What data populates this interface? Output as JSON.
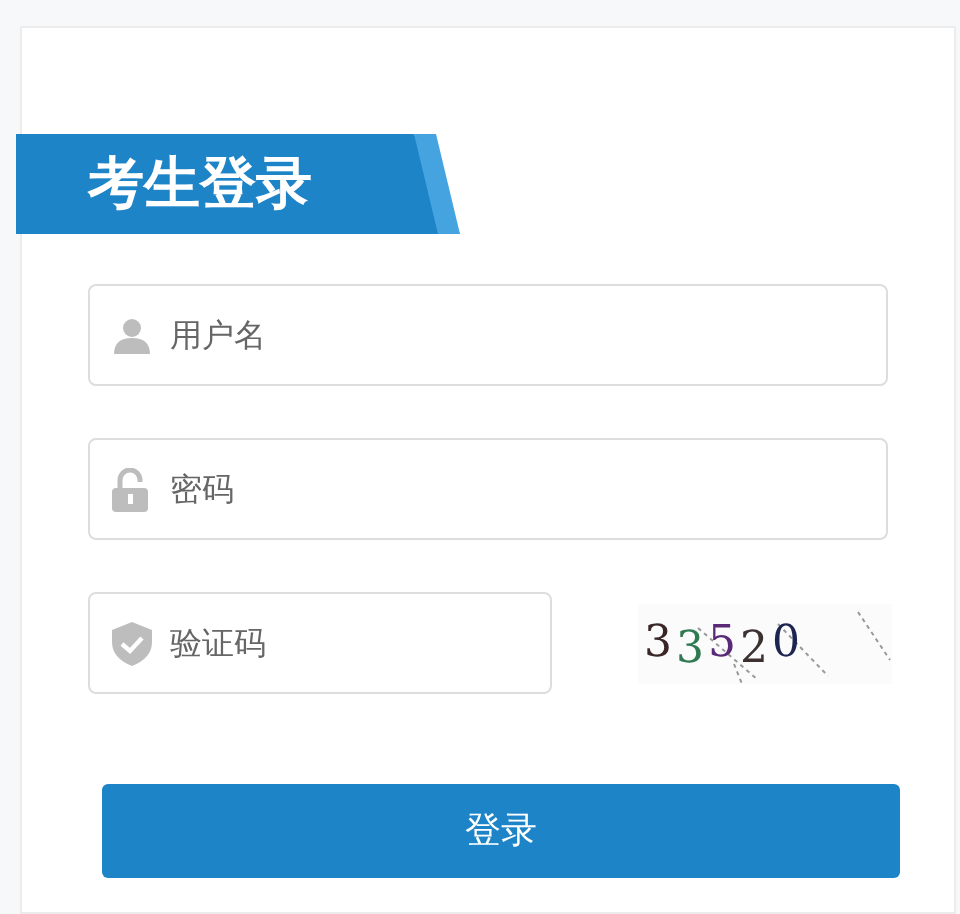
{
  "title": "考生登录",
  "fields": [
    {
      "kind": "user",
      "placeholder": "用户名"
    },
    {
      "kind": "password",
      "placeholder": "密码"
    },
    {
      "kind": "captcha",
      "placeholder": "验证码"
    }
  ],
  "captcha": [
    {
      "text": "3",
      "color": "#3a2626"
    },
    {
      "text": "3",
      "color": "#2f7a52"
    },
    {
      "text": "5",
      "color": "#5a2a78"
    },
    {
      "text": "2",
      "color": "#3c3030"
    },
    {
      "text": "0",
      "color": "#1c2450"
    }
  ],
  "login_button": "登录"
}
